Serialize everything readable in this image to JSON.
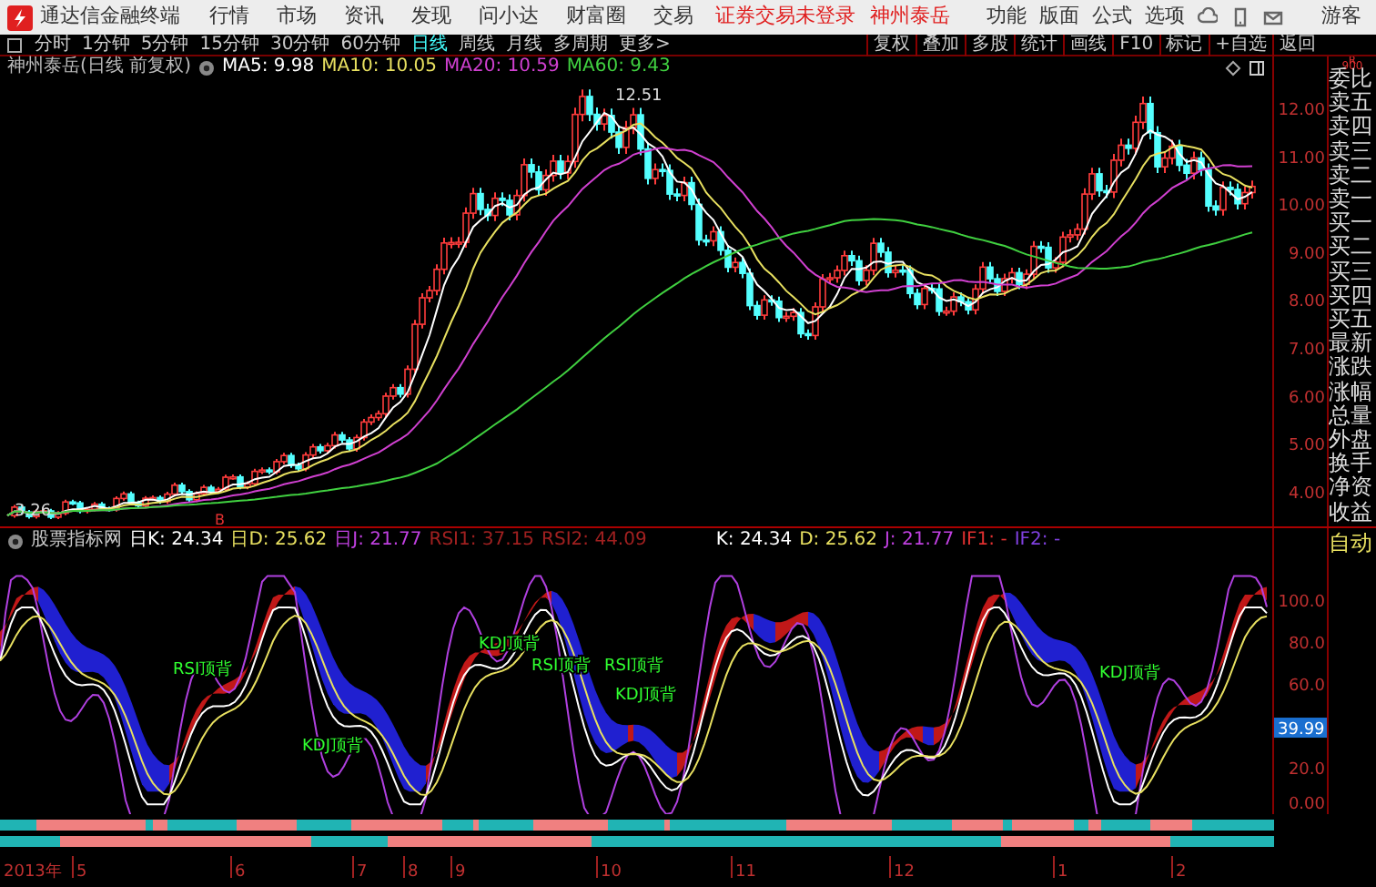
{
  "app": {
    "title": "通达信金融终端"
  },
  "menu": [
    "行情",
    "市场",
    "资讯",
    "发现",
    "问小达",
    "财富圈",
    "交易"
  ],
  "login_notice": "证券交易未登录",
  "stock_link": "神州泰岳",
  "right_menu": [
    "功能",
    "版面",
    "公式",
    "选项"
  ],
  "user": "游客",
  "periods": [
    {
      "label": "分时",
      "selected": false
    },
    {
      "label": "1分钟",
      "selected": false
    },
    {
      "label": "5分钟",
      "selected": false
    },
    {
      "label": "15分钟",
      "selected": false
    },
    {
      "label": "30分钟",
      "selected": false
    },
    {
      "label": "60分钟",
      "selected": false
    },
    {
      "label": "日线",
      "selected": true
    },
    {
      "label": "周线",
      "selected": false
    },
    {
      "label": "月线",
      "selected": false
    },
    {
      "label": "多周期",
      "selected": false
    },
    {
      "label": "更多>",
      "selected": false
    }
  ],
  "tools": [
    "复权",
    "叠加",
    "多股",
    "统计",
    "画线",
    "F10",
    "标记",
    "+自选",
    "返回"
  ],
  "price_chart": {
    "title": "神州泰岳(日线 前复权)",
    "moving_averages": [
      {
        "label": "MA5: 9.98",
        "color": "#ffffff"
      },
      {
        "label": "MA10: 10.05",
        "color": "#e8e060"
      },
      {
        "label": "MA20: 10.59",
        "color": "#d040d0"
      },
      {
        "label": "MA60: 9.43",
        "color": "#40d040"
      }
    ],
    "high_label": "12.51",
    "low_label": "3.26",
    "signal_mark": "B",
    "axis_labels": [
      "12.00",
      "11.00",
      "10.00",
      "9.00",
      "8.00",
      "7.00",
      "6.00",
      "5.00",
      "4.00"
    ]
  },
  "quote_panel": {
    "header": [
      "R",
      "900"
    ],
    "labels": [
      "委比",
      "卖五",
      "卖四",
      "卖三",
      "卖二",
      "卖一",
      "买一",
      "买二",
      "买三",
      "买四",
      "买五",
      "最新",
      "涨跌",
      "涨幅",
      "总量",
      "外盘",
      "换手",
      "净资",
      "收益"
    ]
  },
  "indicator": {
    "name": "股票指标网",
    "values": [
      {
        "label": "日K: 24.34",
        "color": "#ffffff"
      },
      {
        "label": "日D: 25.62",
        "color": "#e8e060"
      },
      {
        "label": "日J: 21.77",
        "color": "#c040e0"
      },
      {
        "label": "RSI1: 37.15",
        "color": "#a02020"
      },
      {
        "label": "RSI2: 44.09",
        "color": "#a02020"
      },
      {
        "label": "K: 24.34",
        "color": "#ffffff"
      },
      {
        "label": "D: 25.62",
        "color": "#e8e060"
      },
      {
        "label": "J: 21.77",
        "color": "#c040e0"
      },
      {
        "label": "IF1: -",
        "color": "#e03030"
      },
      {
        "label": "IF2: -",
        "color": "#8040e0"
      }
    ],
    "signals": [
      "RSI顶背",
      "KDJ顶背",
      "KDJ顶背",
      "RSI顶背",
      "RSI顶背",
      "KDJ顶背",
      "KDJ顶背"
    ],
    "axis_labels": [
      "100.0",
      "80.0",
      "60.0",
      "20.0",
      "0.00"
    ],
    "current_value": "39.99",
    "mode": "自动"
  },
  "date_axis": [
    "2013年",
    "5",
    "6",
    "7",
    "8",
    "9",
    "10",
    "11",
    "12",
    "1",
    "2"
  ]
}
